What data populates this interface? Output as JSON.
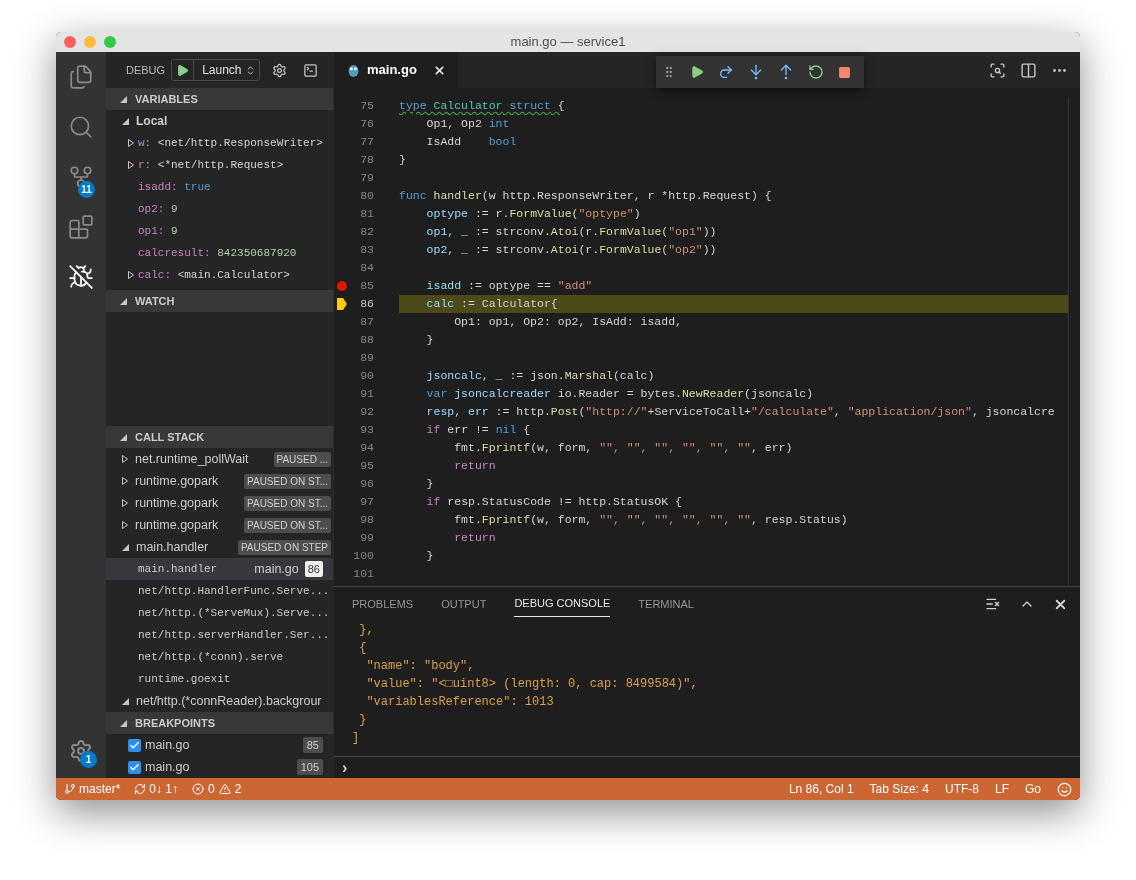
{
  "window": {
    "title": "main.go — service1"
  },
  "activity_bar": {
    "items": [
      {
        "kind": "explorer",
        "selected": false
      },
      {
        "kind": "search",
        "selected": false
      },
      {
        "kind": "scm",
        "selected": false,
        "badge": "11"
      },
      {
        "kind": "extensions",
        "selected": false
      },
      {
        "kind": "debug",
        "selected": true
      }
    ],
    "settings_badge": "1"
  },
  "debug_toolbar": {
    "label": "DEBUG",
    "configuration": "Launch"
  },
  "variables": {
    "title": "VARIABLES",
    "scopes": [
      {
        "name": "Local",
        "expanded": true,
        "children": [
          {
            "name": "w:",
            "value": "<net/http.ResponseWriter>",
            "kind": "object",
            "expanded": false
          },
          {
            "name": "r:",
            "value": "<*net/http.Request>",
            "kind": "object",
            "expanded": false
          },
          {
            "name": "isadd:",
            "value": "true",
            "kind": "boolean"
          },
          {
            "name": "op2:",
            "value": "9",
            "kind": "number"
          },
          {
            "name": "op1:",
            "value": "9",
            "kind": "number"
          },
          {
            "name": "calcresult:",
            "value": "842350687920",
            "kind": "number"
          },
          {
            "name": "calc:",
            "value": "<main.Calculator>",
            "kind": "object",
            "expanded": false
          }
        ]
      }
    ]
  },
  "watch": {
    "title": "WATCH"
  },
  "call_stack": {
    "title": "CALL STACK",
    "threads": [
      {
        "name": "net.runtime_pollWait",
        "status": "PAUSED ...",
        "expanded": false
      },
      {
        "name": "runtime.gopark",
        "status": "PAUSED ON ST...",
        "expanded": false
      },
      {
        "name": "runtime.gopark",
        "status": "PAUSED ON ST...",
        "expanded": false
      },
      {
        "name": "runtime.gopark",
        "status": "PAUSED ON ST...",
        "expanded": false
      },
      {
        "name": "main.handler",
        "status": "PAUSED ON STEP",
        "expanded": true,
        "frames": [
          {
            "name": "main.handler",
            "file": "main.go",
            "line": "86",
            "selected": true
          },
          {
            "name": "net/http.HandlerFunc.Serve...",
            "selected": false
          },
          {
            "name": "net/http.(*ServeMux).Serve...",
            "selected": false
          },
          {
            "name": "net/http.serverHandler.Ser...",
            "selected": false
          },
          {
            "name": "net/http.(*conn).serve",
            "selected": false
          },
          {
            "name": "runtime.goexit",
            "selected": false
          }
        ]
      },
      {
        "name": "net/http.(*connReader).backgrour",
        "expanded": true
      }
    ]
  },
  "breakpoints": {
    "title": "BREAKPOINTS",
    "items": [
      {
        "file": "main.go",
        "line": "85",
        "checked": true
      },
      {
        "file": "main.go",
        "line": "105",
        "checked": true
      }
    ]
  },
  "editor": {
    "tabs": [
      {
        "label": "main.go",
        "selected": true
      }
    ],
    "lines": [
      {
        "number": "75",
        "breakpoint": false,
        "current": false,
        "warning": true,
        "tokens": [
          {
            "t": "type",
            "kind": "kw"
          },
          {
            "t": " Calculator",
            "kind": "type"
          },
          {
            "t": " struct",
            "kind": "kw"
          },
          {
            "t": " {"
          }
        ]
      },
      {
        "number": "76",
        "breakpoint": false,
        "current": false,
        "warning": false,
        "tokens": [
          {
            "t": "    Op1, Op2 "
          },
          {
            "t": "int",
            "kind": "kw"
          }
        ]
      },
      {
        "number": "77",
        "breakpoint": false,
        "current": false,
        "warning": false,
        "tokens": [
          {
            "t": "    IsAdd    "
          },
          {
            "t": "bool",
            "kind": "kw"
          }
        ]
      },
      {
        "number": "78",
        "breakpoint": false,
        "current": false,
        "warning": false,
        "tokens": [
          {
            "t": "}"
          }
        ]
      },
      {
        "number": "79",
        "breakpoint": false,
        "current": false
      },
      {
        "number": "80",
        "breakpoint": false,
        "current": false,
        "warning": false,
        "tokens": [
          {
            "t": "func",
            "kind": "kw"
          },
          {
            "t": " handler",
            "kind": "func"
          },
          {
            "t": "(w http.ResponseWriter, r *http.Request) {"
          }
        ]
      },
      {
        "number": "81",
        "breakpoint": false,
        "current": false,
        "warning": false,
        "tokens": [
          {
            "t": "    optype",
            "kind": "var"
          },
          {
            "t": " := r."
          },
          {
            "t": "FormValue",
            "kind": "func"
          },
          {
            "t": "("
          },
          {
            "t": "\"optype\"",
            "kind": "str"
          },
          {
            "t": ")"
          }
        ]
      },
      {
        "number": "82",
        "breakpoint": false,
        "current": false,
        "warning": false,
        "tokens": [
          {
            "t": "    op1, _",
            "kind": "var"
          },
          {
            "t": " := strconv."
          },
          {
            "t": "Atoi",
            "kind": "func"
          },
          {
            "t": "(r."
          },
          {
            "t": "FormValue",
            "kind": "func"
          },
          {
            "t": "("
          },
          {
            "t": "\"op1\"",
            "kind": "str"
          },
          {
            "t": "))"
          }
        ]
      },
      {
        "number": "83",
        "breakpoint": false,
        "current": false,
        "warning": false,
        "tokens": [
          {
            "t": "    op2, _",
            "kind": "var"
          },
          {
            "t": " := strconv."
          },
          {
            "t": "Atoi",
            "kind": "func"
          },
          {
            "t": "(r."
          },
          {
            "t": "FormValue",
            "kind": "func"
          },
          {
            "t": "("
          },
          {
            "t": "\"op2\"",
            "kind": "str"
          },
          {
            "t": "))"
          }
        ]
      },
      {
        "number": "84",
        "breakpoint": false,
        "current": false
      },
      {
        "number": "85",
        "breakpoint": true,
        "current": false,
        "warning": false,
        "tokens": [
          {
            "t": "    isadd",
            "kind": "var"
          },
          {
            "t": " := optype == "
          },
          {
            "t": "\"add\"",
            "kind": "str"
          }
        ]
      },
      {
        "number": "86",
        "breakpoint": false,
        "current": true,
        "warning": false,
        "tokens": [
          {
            "t": "    calc",
            "kind": "var"
          },
          {
            "t": " := Calculator{"
          }
        ]
      },
      {
        "number": "87",
        "breakpoint": false,
        "current": false,
        "warning": false,
        "tokens": [
          {
            "t": "        Op1: op1, Op2: op2, IsAdd: isadd,"
          }
        ]
      },
      {
        "number": "88",
        "breakpoint": false,
        "current": false,
        "warning": false,
        "tokens": [
          {
            "t": "    }"
          }
        ]
      },
      {
        "number": "89",
        "breakpoint": false,
        "current": false
      },
      {
        "number": "90",
        "breakpoint": false,
        "current": false,
        "warning": false,
        "tokens": [
          {
            "t": "    jsoncalc, _",
            "kind": "var"
          },
          {
            "t": " := json."
          },
          {
            "t": "Marshal",
            "kind": "func"
          },
          {
            "t": "(calc)"
          }
        ]
      },
      {
        "number": "91",
        "breakpoint": false,
        "current": false,
        "warning": false,
        "tokens": [
          {
            "t": "    var",
            "kind": "kw"
          },
          {
            "t": " jsoncalcreader",
            "kind": "var"
          },
          {
            "t": " io.Reader = bytes."
          },
          {
            "t": "NewReader",
            "kind": "func"
          },
          {
            "t": "(jsoncalc)"
          }
        ]
      },
      {
        "number": "92",
        "breakpoint": false,
        "current": false,
        "warning": false,
        "tokens": [
          {
            "t": "    resp, err",
            "kind": "var"
          },
          {
            "t": " := http."
          },
          {
            "t": "Post",
            "kind": "func"
          },
          {
            "t": "("
          },
          {
            "t": "\"http://\"",
            "kind": "str"
          },
          {
            "t": "+ServiceToCall+"
          },
          {
            "t": "\"/calculate\"",
            "kind": "str"
          },
          {
            "t": ", "
          },
          {
            "t": "\"application/json\"",
            "kind": "str"
          },
          {
            "t": ", jsoncalcre"
          }
        ]
      },
      {
        "number": "93",
        "breakpoint": false,
        "current": false,
        "warning": false,
        "tokens": [
          {
            "t": "    if",
            "kind": "ctrl"
          },
          {
            "t": " err != "
          },
          {
            "t": "nil",
            "kind": "kw"
          },
          {
            "t": " {"
          }
        ]
      },
      {
        "number": "94",
        "breakpoint": false,
        "current": false,
        "warning": false,
        "tokens": [
          {
            "t": "        fmt."
          },
          {
            "t": "Fprintf",
            "kind": "func"
          },
          {
            "t": "(w, form, "
          },
          {
            "t": "\"\", \"\", \"\", \"\", \"\", \"\"",
            "kind": "str"
          },
          {
            "t": ", err)"
          }
        ]
      },
      {
        "number": "95",
        "breakpoint": false,
        "current": false,
        "warning": false,
        "tokens": [
          {
            "t": "        return",
            "kind": "ctrl"
          }
        ]
      },
      {
        "number": "96",
        "breakpoint": false,
        "current": false,
        "warning": false,
        "tokens": [
          {
            "t": "    }"
          }
        ]
      },
      {
        "number": "97",
        "breakpoint": false,
        "current": false,
        "warning": false,
        "tokens": [
          {
            "t": "    if",
            "kind": "ctrl"
          },
          {
            "t": " resp.StatusCode != http.StatusOK {"
          }
        ]
      },
      {
        "number": "98",
        "breakpoint": false,
        "current": false,
        "warning": false,
        "tokens": [
          {
            "t": "        fmt."
          },
          {
            "t": "Fprintf",
            "kind": "func"
          },
          {
            "t": "(w, form, "
          },
          {
            "t": "\"\", \"\", \"\", \"\", \"\", \"\"",
            "kind": "str"
          },
          {
            "t": ", resp.Status)"
          }
        ]
      },
      {
        "number": "99",
        "breakpoint": false,
        "current": false,
        "warning": false,
        "tokens": [
          {
            "t": "        return",
            "kind": "ctrl"
          }
        ]
      },
      {
        "number": "100",
        "breakpoint": false,
        "current": false,
        "warning": false,
        "tokens": [
          {
            "t": "    }"
          }
        ]
      },
      {
        "number": "101",
        "breakpoint": false,
        "current": false
      }
    ]
  },
  "panel": {
    "tabs": [
      {
        "label": "PROBLEMS",
        "selected": false
      },
      {
        "label": "OUTPUT",
        "selected": false
      },
      {
        "label": "DEBUG CONSOLE",
        "selected": true
      },
      {
        "label": "TERMINAL",
        "selected": false
      }
    ],
    "console_lines": [
      " },",
      " {",
      "  \"name\": \"body\",",
      "  \"value\": \"<□uint8> (length: 0, cap: 8499584)\",",
      "  \"variablesReference\": 1013",
      " }",
      "]"
    ],
    "prompt": "›"
  },
  "status_bar": {
    "branch": "master*",
    "sync": "0↓ 1↑",
    "errors": "0",
    "warnings": "2",
    "items": [
      "Ln 86, Col 1",
      "Tab Size: 4",
      "UTF-8",
      "LF",
      "Go"
    ]
  }
}
